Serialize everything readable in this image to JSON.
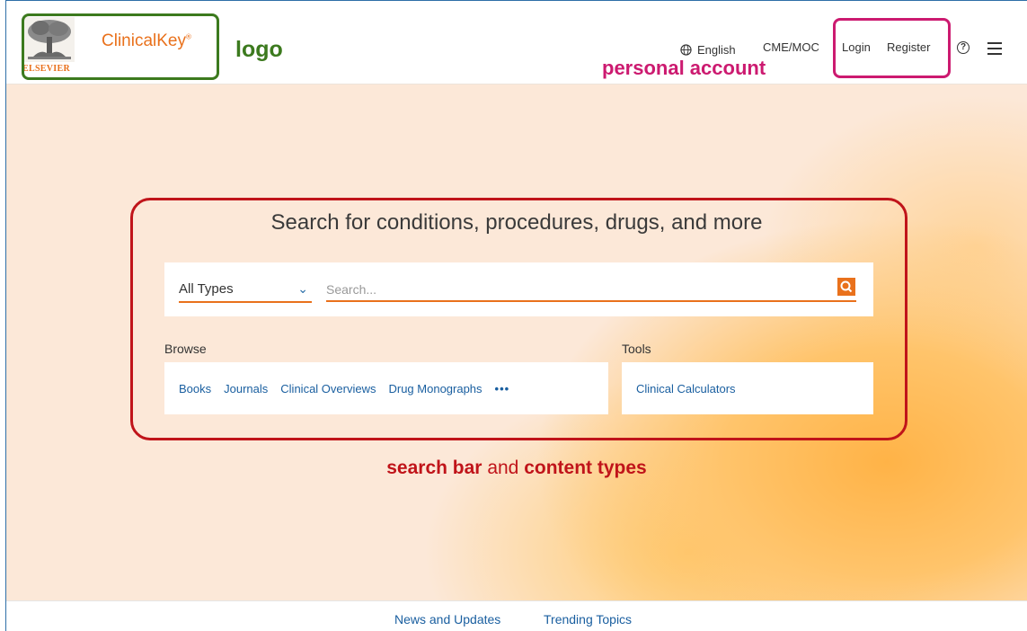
{
  "header": {
    "brand": "ClinicalKey",
    "brand_mark": "®",
    "publisher": "ELSEVIER",
    "nav": {
      "language": "English",
      "cme": "CME/MOC",
      "login": "Login",
      "register": "Register",
      "help_glyph": "?"
    }
  },
  "hero": {
    "title": "Search for conditions, procedures, drugs, and more",
    "search": {
      "type_selected": "All Types",
      "placeholder": "Search..."
    },
    "browse": {
      "label": "Browse",
      "links": [
        "Books",
        "Journals",
        "Clinical Overviews",
        "Drug Monographs"
      ],
      "more": "•••"
    },
    "tools": {
      "label": "Tools",
      "link": "Clinical Calculators"
    }
  },
  "footer": {
    "links": [
      "News and Updates",
      "Trending Topics"
    ]
  },
  "annotations": {
    "logo": "logo",
    "account": "personal account",
    "search_part1": "search bar",
    "search_part2": " and ",
    "search_part3": "content types"
  },
  "colors": {
    "accent": "#e9711c",
    "link": "#1a5fa0",
    "annotation_logo": "#3c7a1e",
    "annotation_account": "#cc1a70",
    "annotation_search": "#c0141a"
  },
  "icons": [
    "elsevier-tree-icon",
    "globe-icon",
    "chevron-down-icon",
    "search-icon",
    "help-icon",
    "menu-icon",
    "more-dots-icon"
  ]
}
